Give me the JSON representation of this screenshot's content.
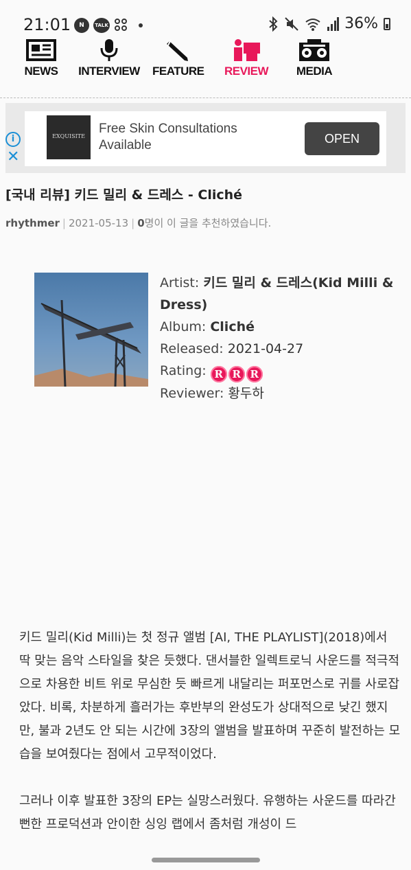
{
  "status_bar": {
    "time": "21:01",
    "app_icons": [
      "N",
      "TALK"
    ],
    "battery": "36%"
  },
  "nav": {
    "items": [
      {
        "label": "NEWS",
        "icon": "newspaper-icon"
      },
      {
        "label": "INTERVIEW",
        "icon": "microphone-icon"
      },
      {
        "label": "FEATURE",
        "icon": "pencil-icon"
      },
      {
        "label": "REVIEW",
        "icon": "review-icon",
        "active": true
      },
      {
        "label": "MEDIA",
        "icon": "boombox-icon"
      }
    ],
    "active_color": "#e8185a"
  },
  "ad": {
    "logo_text": "EXQUISITE",
    "text": "Free Skin Consultations Available",
    "button": "OPEN",
    "info_glyph": "i",
    "close_glyph": "✕"
  },
  "article": {
    "title": "[국내 리뷰] 키드 밀리 & 드레스 - Cliché",
    "author": "rhythmer",
    "date": "2021-05-13",
    "recommend_count": "0",
    "recommend_text": "명이 이 글을 추천하였습니다."
  },
  "album": {
    "artist_label": "Artist:",
    "artist": "키드 밀리 & 드레스(Kid Milli & Dress)",
    "album_label": "Album:",
    "album": "Cliché",
    "released_label": "Released:",
    "released": "2021-04-27",
    "rating_label": "Rating:",
    "rating_glyph": "R",
    "rating_value": 3,
    "reviewer_label": "Reviewer:",
    "reviewer": "황두하"
  },
  "body": {
    "paragraphs": [
      "키드 밀리(Kid Milli)는 첫 정규 앨범 [AI, THE PLAYLIST](2018)에서 딱 맞는 음악 스타일을 찾은 듯했다. 댄서블한 일렉트로닉 사운드를 적극적으로 차용한 비트 위로 무심한 듯 빠르게 내달리는 퍼포먼스로 귀를 사로잡았다. 비록, 차분하게 흘러가는 후반부의 완성도가 상대적으로 낮긴 했지만, 불과 2년도 안 되는 시간에 3장의 앨범을 발표하며 꾸준히 발전하는 모습을 보여줬다는 점에서 고무적이었다.",
      "그러나 이후 발표한 3장의 EP는 실망스러웠다. 유행하는 사운드를 따라간 뻔한 프로덕션과 안이한 싱잉 랩에서 좀처럼 개성이 드"
    ]
  }
}
